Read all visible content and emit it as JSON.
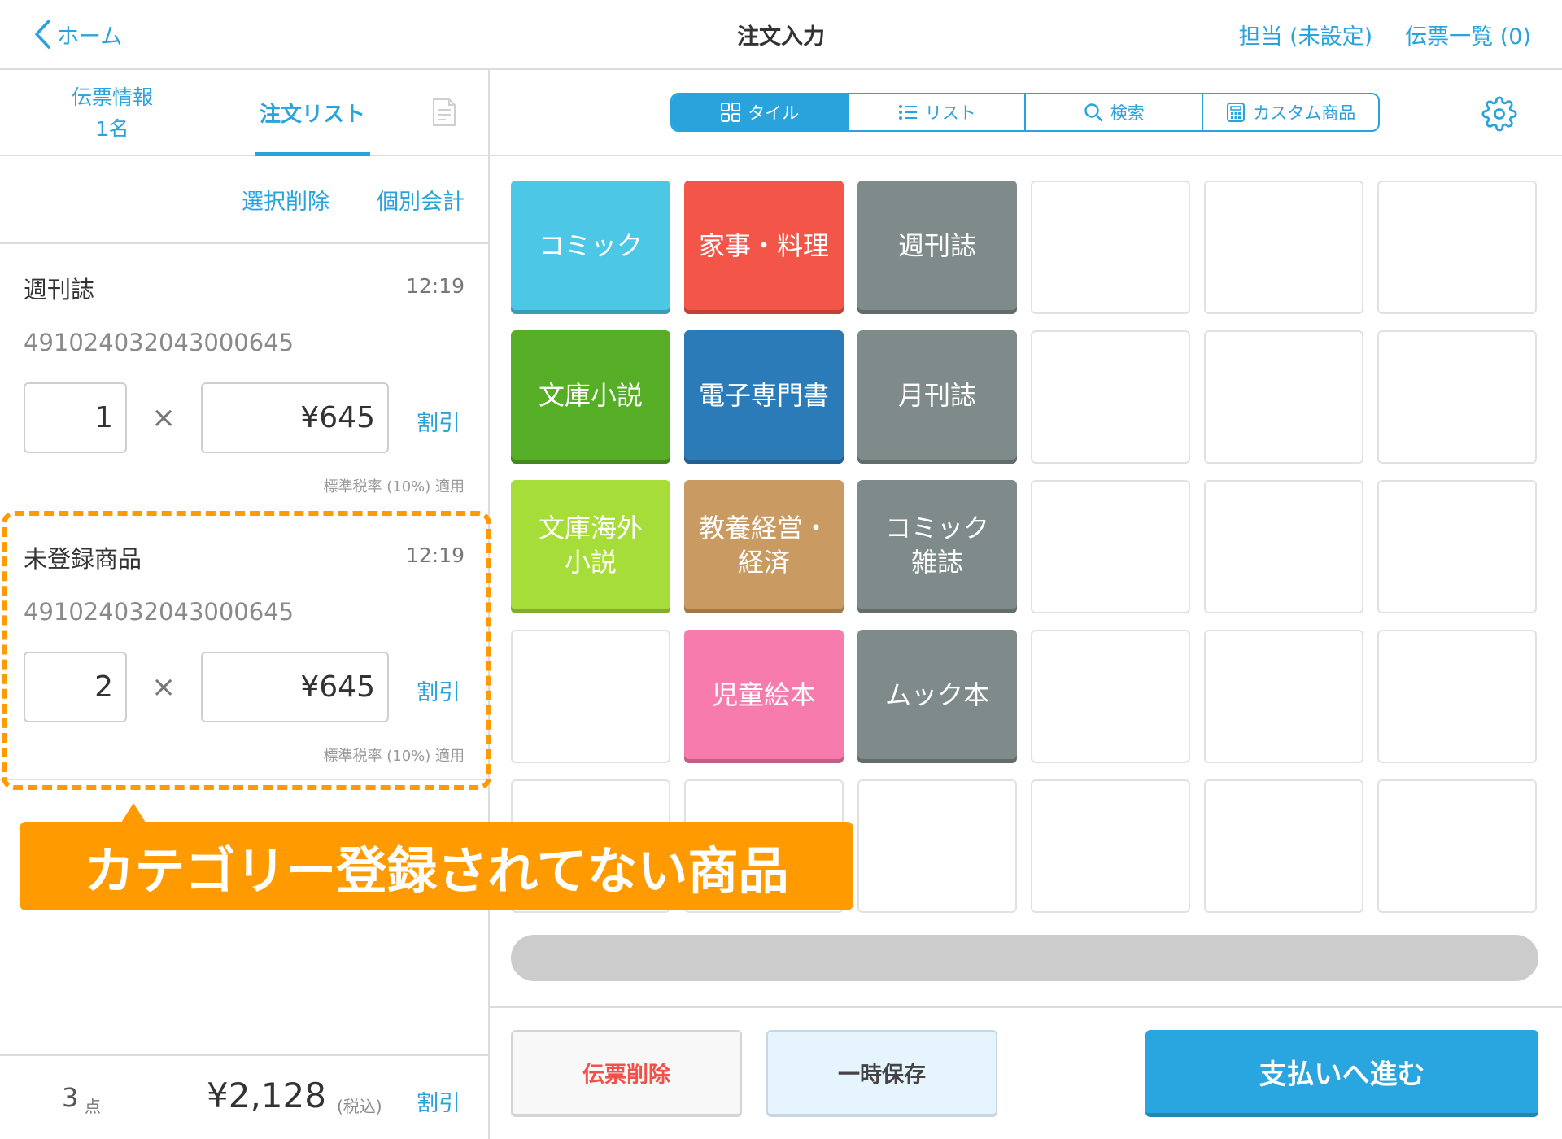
{
  "colors": {
    "accent": "#2aa3dc",
    "highlight": "#ff9b00",
    "danger": "#f0524a",
    "pay": "#29a6df"
  },
  "header": {
    "back_label": "ホーム",
    "title": "注文入力",
    "staff_label": "担当 (未設定)",
    "slips_label": "伝票一覧 (0)"
  },
  "left_tabs": {
    "slip_info_label": "伝票情報",
    "slip_info_count": "1名",
    "order_list_label": "注文リスト",
    "receipt_icon": "receipt-icon"
  },
  "order_actions": {
    "delete_selected": "選択削除",
    "split_checkout": "個別会計"
  },
  "order_items": [
    {
      "name": "週刊誌",
      "time": "12:19",
      "code": "491024032043000645",
      "quantity": "1",
      "times": "×",
      "price": "¥645",
      "discount_label": "割引",
      "tax_note": "標準税率 (10%) 適用"
    },
    {
      "name": "未登録商品",
      "time": "12:19",
      "code": "491024032043000645",
      "quantity": "2",
      "times": "×",
      "price": "¥645",
      "discount_label": "割引",
      "tax_note": "標準税率 (10%) 適用"
    }
  ],
  "summary": {
    "count": "3",
    "count_unit": "点",
    "total": "¥2,128",
    "tax_label": "(税込)",
    "discount_label": "割引"
  },
  "view_modes": [
    {
      "label": "タイル",
      "icon": "grid-icon",
      "active": true
    },
    {
      "label": "リスト",
      "icon": "list-icon",
      "active": false
    },
    {
      "label": "検索",
      "icon": "search-icon",
      "active": false
    },
    {
      "label": "カスタム商品",
      "icon": "calculator-icon",
      "active": false
    }
  ],
  "settings_icon": "gear-icon",
  "tiles": [
    {
      "lines": [
        "コミック"
      ],
      "color": "#4cc8e6"
    },
    {
      "lines": [
        "家事・料理"
      ],
      "color": "#f45549"
    },
    {
      "lines": [
        "週刊誌"
      ],
      "color": "#7f8b8a"
    },
    {
      "lines": [],
      "color": ""
    },
    {
      "lines": [],
      "color": ""
    },
    {
      "lines": [],
      "color": ""
    },
    {
      "lines": [
        "文庫小説"
      ],
      "color": "#56ae27"
    },
    {
      "lines": [
        "電子専門書"
      ],
      "color": "#2b7bb9"
    },
    {
      "lines": [
        "月刊誌"
      ],
      "color": "#7f8b8a"
    },
    {
      "lines": [],
      "color": ""
    },
    {
      "lines": [],
      "color": ""
    },
    {
      "lines": [],
      "color": ""
    },
    {
      "lines": [
        "文庫海外",
        "小説"
      ],
      "color": "#a6dd39"
    },
    {
      "lines": [
        "教養経営・",
        "経済"
      ],
      "color": "#c99b62"
    },
    {
      "lines": [
        "コミック",
        "雑誌"
      ],
      "color": "#7f8b8a"
    },
    {
      "lines": [],
      "color": ""
    },
    {
      "lines": [],
      "color": ""
    },
    {
      "lines": [],
      "color": ""
    },
    {
      "lines": [],
      "color": ""
    },
    {
      "lines": [
        "児童絵本"
      ],
      "color": "#f77bad"
    },
    {
      "lines": [
        "ムック本"
      ],
      "color": "#7f8b8a"
    },
    {
      "lines": [],
      "color": ""
    },
    {
      "lines": [],
      "color": ""
    },
    {
      "lines": [],
      "color": ""
    },
    {
      "lines": [],
      "color": ""
    },
    {
      "lines": [],
      "color": ""
    },
    {
      "lines": [],
      "color": ""
    },
    {
      "lines": [],
      "color": ""
    },
    {
      "lines": [],
      "color": ""
    },
    {
      "lines": [],
      "color": ""
    }
  ],
  "footer_buttons": {
    "delete_slip": "伝票削除",
    "hold": "一時保存",
    "proceed": "支払いへ進む"
  },
  "callout": {
    "text": "カテゴリー登録されてない商品"
  }
}
